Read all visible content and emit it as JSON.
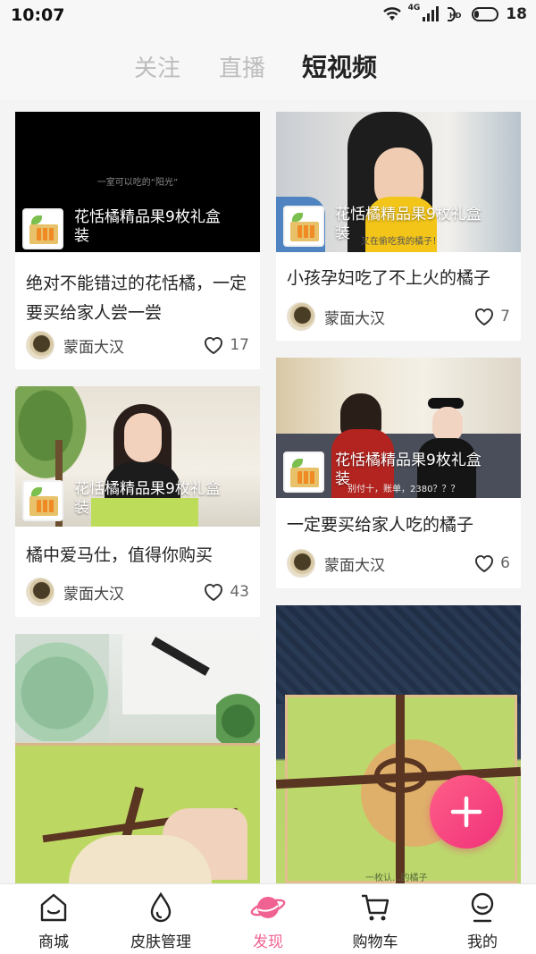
{
  "status_bar": {
    "time": "10:07",
    "battery": "18",
    "signal_label": "4G"
  },
  "tabs": [
    {
      "label": "关注",
      "active": false
    },
    {
      "label": "直播",
      "active": false
    },
    {
      "label": "短视频",
      "active": true
    }
  ],
  "videos": [
    {
      "thumb_caption": "一室可以吃的“阳光”",
      "product": "花恬橘精品果9枚礼盒装",
      "title": "绝对不能错过的花恬橘，一定要买给家人尝一尝",
      "author": "蒙面大汉",
      "likes": "17"
    },
    {
      "thumb_caption": "又在偷吃我的橘子！",
      "product": "花恬橘精品果9枚礼盒装",
      "title": "小孩孕妇吃了不上火的橘子",
      "author": "蒙面大汉",
      "likes": "7"
    },
    {
      "thumb_caption": "",
      "product": "花恬橘精品果9枚礼盒装",
      "title": "橘中爱马仕，值得你购买",
      "author": "蒙面大汉",
      "likes": "43"
    },
    {
      "thumb_caption": "别付十，账单，2380？？？",
      "product": "花恬橘精品果9枚礼盒装",
      "title": "一定要买给家人吃的橘子",
      "author": "蒙面大汉",
      "likes": "6"
    },
    {
      "thumb_caption": "",
      "product": "",
      "title": "",
      "author": "",
      "likes": ""
    },
    {
      "thumb_caption": "一枚认...的橘子",
      "product": "",
      "title": "",
      "author": "",
      "likes": ""
    }
  ],
  "fab": {
    "icon": "plus-icon"
  },
  "bottom_nav": [
    {
      "label": "商城",
      "icon": "shop-icon",
      "active": false
    },
    {
      "label": "皮肤管理",
      "icon": "drop-icon",
      "active": false
    },
    {
      "label": "发现",
      "icon": "planet-icon",
      "active": true
    },
    {
      "label": "购物车",
      "icon": "cart-icon",
      "active": false
    },
    {
      "label": "我的",
      "icon": "profile-icon",
      "active": false
    }
  ],
  "colors": {
    "accent": "#f06292",
    "fab": "#f0317a",
    "background": "#f4f4f4"
  }
}
